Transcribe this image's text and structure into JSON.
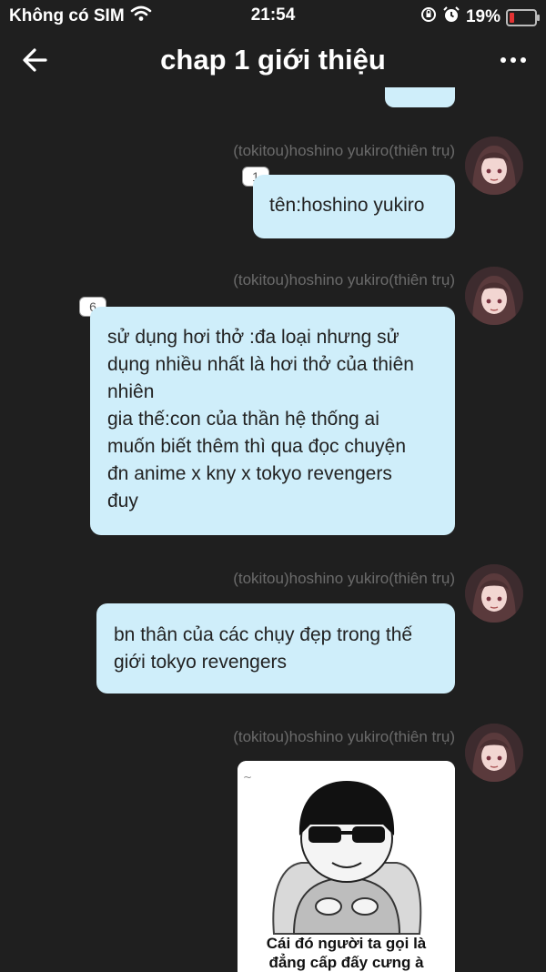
{
  "status_bar": {
    "carrier": "Không có SIM",
    "time": "21:54",
    "battery_percent": "19%",
    "battery_color": "#e33333",
    "icons": [
      "wifi-icon",
      "orientation-lock-icon",
      "alarm-icon",
      "battery-icon"
    ]
  },
  "header": {
    "title": "chap 1 giới thiệu",
    "back_icon": "back-arrow-icon",
    "more_icon": "more-options-icon"
  },
  "messages": [
    {
      "sender": "(tokitou)hoshino yukiro(thiên trụ)",
      "badge": "1",
      "lines": [
        "tên:hoshino yukiro"
      ]
    },
    {
      "sender": "(tokitou)hoshino yukiro(thiên trụ)",
      "badge": "6",
      "lines": [
        "sử dụng hơi thở :đa loại nhưng sử",
        "dụng nhiều nhất là hơi thở của thiên",
        "nhiên",
        "gia thế:con của thần hệ thống ai",
        "muốn biết thêm thì qua đọc chuyện",
        "đn anime x kny x tokyo revengers",
        "đuy"
      ]
    },
    {
      "sender": "(tokitou)hoshino yukiro(thiên trụ)",
      "lines": [
        "bn thân của các chụy đẹp trong thế",
        "giới tokyo revengers"
      ]
    },
    {
      "sender": "(tokitou)hoshino yukiro(thiên trụ)",
      "image_caption": [
        "Cái đó người ta gọi là",
        "đẳng cấp đấy cưng à"
      ]
    }
  ],
  "colors": {
    "background": "#1f1f1f",
    "bubble": "#cfeefa",
    "sender_text": "#6b6b6b"
  }
}
